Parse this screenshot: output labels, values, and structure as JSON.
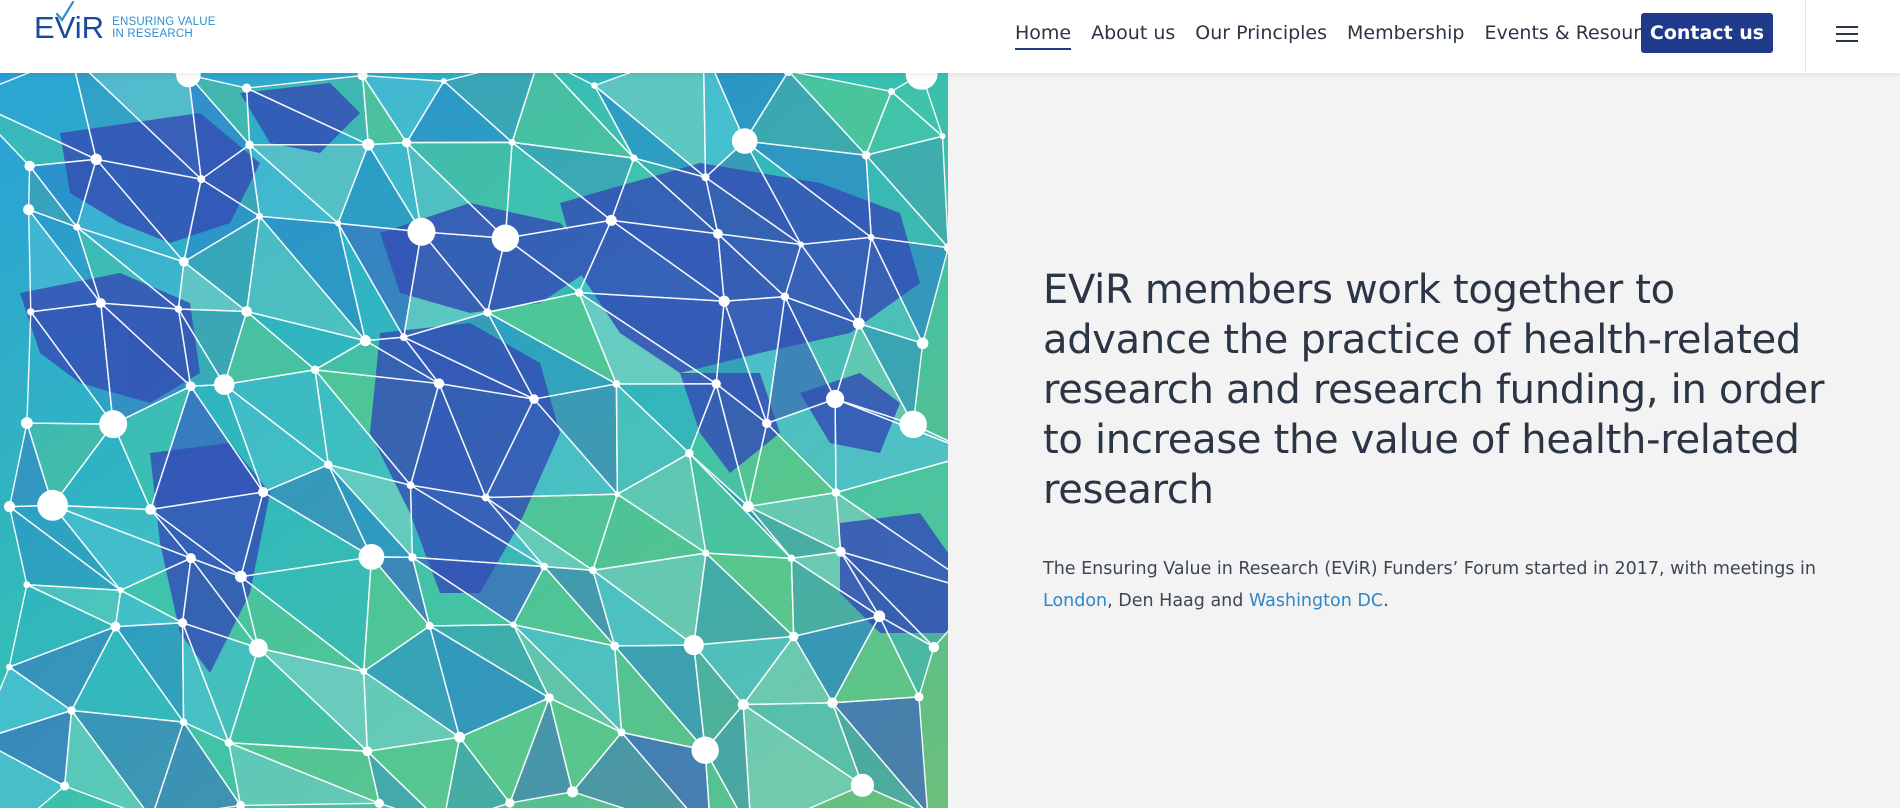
{
  "brand": {
    "mark": "EViR",
    "tagline_line1": "ENSURING VALUE",
    "tagline_line2": "IN RESEARCH",
    "mark_color": "#1b4a9c",
    "tagline_color": "#2f8fcd"
  },
  "nav": {
    "items": [
      {
        "label": "Home",
        "active": true
      },
      {
        "label": "About us",
        "active": false
      },
      {
        "label": "Our Principles",
        "active": false
      },
      {
        "label": "Membership",
        "active": false
      },
      {
        "label": "Events & Resources",
        "active": false
      }
    ],
    "contact_label": "Contact us",
    "menu_icon": "hamburger-menu-icon"
  },
  "hero": {
    "title": "EViR members work together to advance the practice of health-related research and research funding, in order to increase the value of health-related research",
    "desc_prefix": "The Ensuring Value in Research (EViR) Funders’ Forum started in 2017, with meetings in ",
    "link_london": "London",
    "desc_middle": ", Den Haag and ",
    "link_washington": "Washington DC",
    "desc_suffix": ".",
    "image": "world-map-network-illustration"
  },
  "colors": {
    "accent": "#1f3a8a",
    "link": "#2f86c9",
    "text": "#2b3545",
    "panel_bg": "#f3f3f3"
  }
}
